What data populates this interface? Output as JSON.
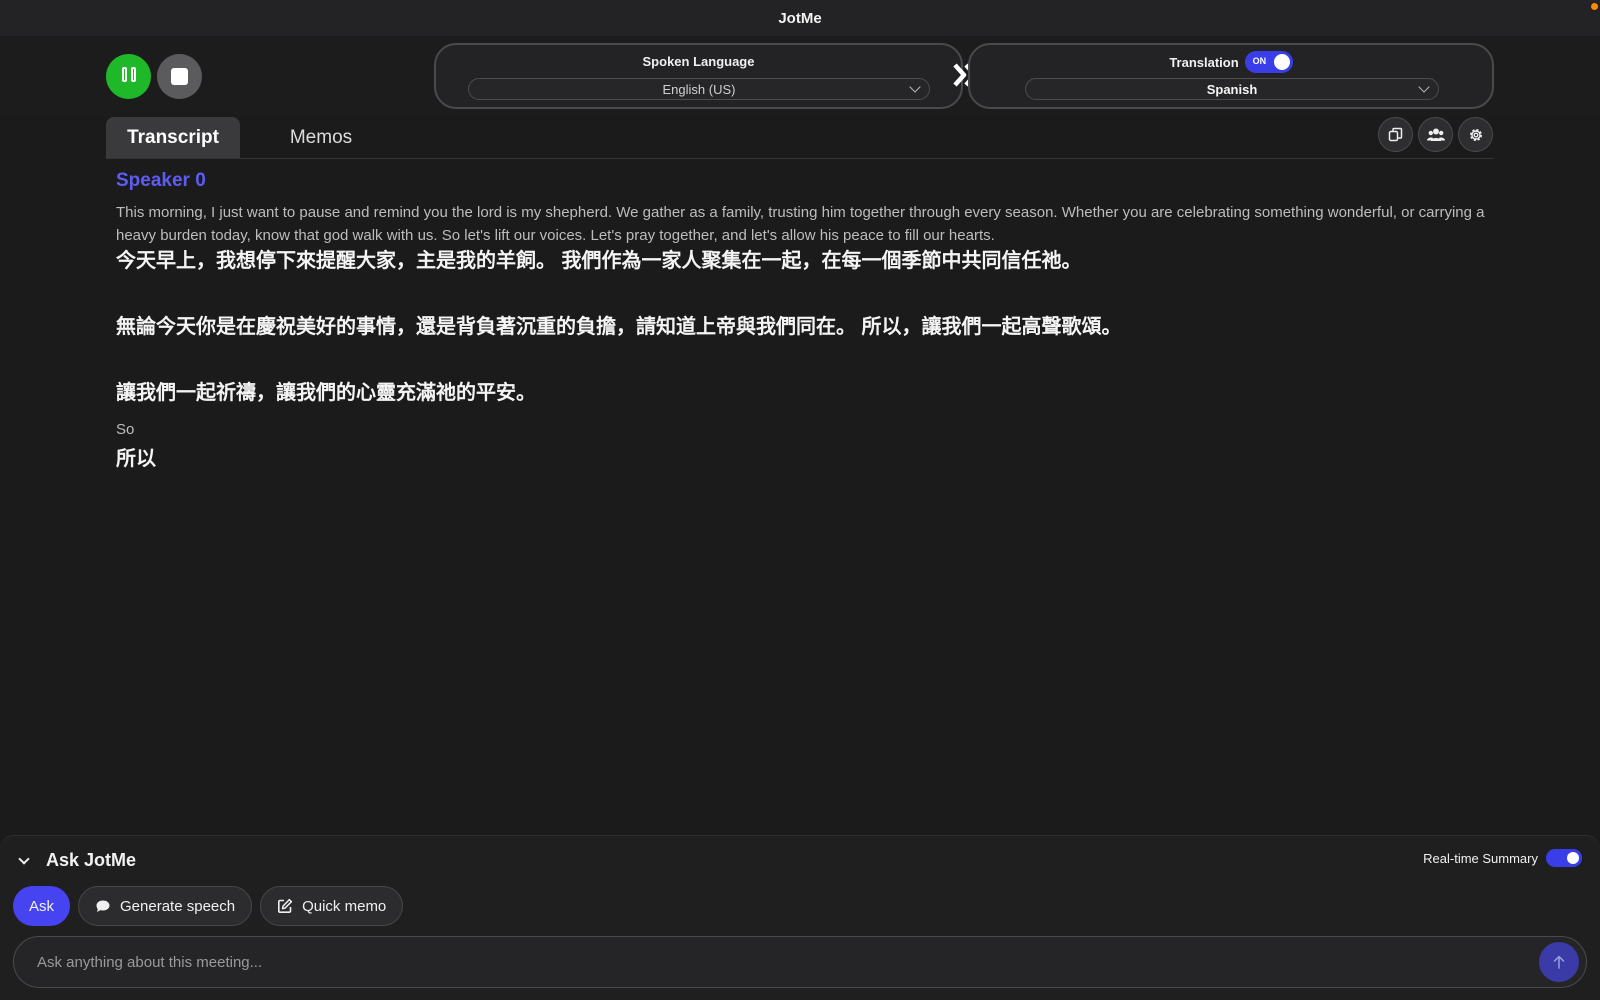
{
  "app": {
    "title": "JotMe"
  },
  "spoken": {
    "title": "Spoken Language",
    "selected": "English (US)"
  },
  "translation": {
    "label": "Translation",
    "toggle": "ON",
    "enabled": true,
    "selected": "Spanish"
  },
  "tabs": [
    {
      "label": "Transcript",
      "active": true
    },
    {
      "label": "Memos",
      "active": false
    }
  ],
  "toolbar_icons": [
    "copy-icon",
    "users-icon",
    "gear-icon"
  ],
  "transcript": {
    "speaker": "Speaker 0",
    "en_1": "This morning, I just want to pause and remind you the lord is my shepherd. We gather as a family, trusting him together through every season. Whether you are celebrating something wonderful, or carrying a heavy burden today, know that god walk with us. So let's lift our voices. Let's pray together, and let's allow his peace to fill our hearts.",
    "zh_1": "今天早上，我想停下來提醒大家，主是我的羊飼。 我們作為一家人聚集在一起，在每一個季節中共同信任祂。",
    "zh_2": "無論今天你是在慶祝美好的事情，還是背負著沉重的負擔，請知道上帝與我們同在。 所以，讓我們一起高聲歌頌。",
    "zh_3": "讓我們一起祈禱，讓我們的心靈充滿祂的平安。",
    "en_2": "So",
    "zh_4": "所以"
  },
  "ask": {
    "title": "Ask JotMe",
    "realtime_label": "Real-time Summary",
    "realtime_enabled": true,
    "chips": {
      "ask": "Ask",
      "generate": "Generate speech",
      "memo": "Quick memo"
    },
    "placeholder": "Ask anything about this meeting..."
  },
  "colors": {
    "accent": "#4643f0",
    "record_green": "#1fb829",
    "speaker": "#5d5df5"
  }
}
